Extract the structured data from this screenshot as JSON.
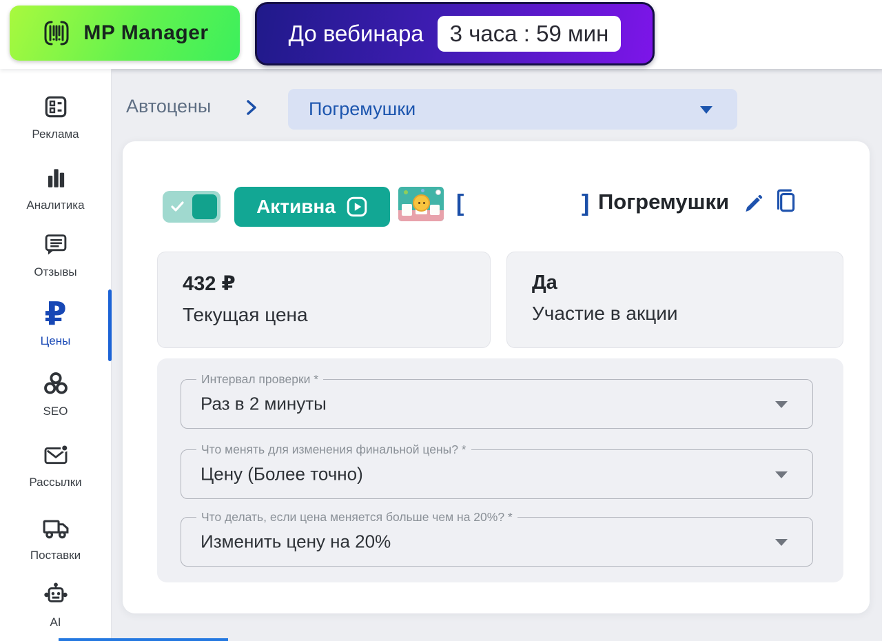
{
  "header": {
    "logo": {
      "label": "MP Manager",
      "icon": "barcode-icon"
    },
    "webinar": {
      "label": "До вебинара",
      "countdown": "3 часа : 59 мин"
    }
  },
  "sidebar": {
    "items": [
      {
        "label": "Реклама",
        "icon": "ads-icon",
        "active": false
      },
      {
        "label": "Аналитика",
        "icon": "analytics-icon",
        "active": false
      },
      {
        "label": "Отзывы",
        "icon": "reviews-icon",
        "active": false
      },
      {
        "label": "Цены",
        "icon": "ruble-icon",
        "icon_glyph": "₽",
        "active": true
      },
      {
        "label": "SEO",
        "icon": "seo-icon",
        "active": false
      },
      {
        "label": "Рассылки",
        "icon": "mailing-icon",
        "active": false
      },
      {
        "label": "Поставки",
        "icon": "truck-icon",
        "active": false
      },
      {
        "label": "AI",
        "icon": "robot-icon",
        "active": false
      }
    ]
  },
  "breadcrumb": {
    "root": "Автоцены",
    "current": "Погремушки"
  },
  "strategy": {
    "toggle_on": true,
    "status_label": "Активна",
    "bracket_open": "[",
    "bracket_close": "]",
    "product_name": "Погремушки",
    "info_cards": [
      {
        "value": "432 ₽",
        "label": "Текущая цена"
      },
      {
        "value": "Да",
        "label": "Участие в акции"
      }
    ],
    "form_fields": [
      {
        "label": "Интервал проверки *",
        "value": "Раз в 2 минуты"
      },
      {
        "label": "Что менять для изменения финальной цены? *",
        "value": "Цену (Более точно)"
      },
      {
        "label": "Что делать, если цена меняется больше чем на 20%? *",
        "value": "Изменить цену на 20%"
      }
    ]
  },
  "icons": [
    "barcode-icon",
    "ads-icon",
    "analytics-icon",
    "reviews-icon",
    "ruble-icon",
    "seo-icon",
    "mailing-icon",
    "truck-icon",
    "robot-icon",
    "chevron-right-icon",
    "dropdown-arrow-icon",
    "check-icon",
    "play-icon",
    "edit-icon",
    "copy-icon"
  ],
  "colors": {
    "accent_teal": "#12a794",
    "toggle_track": "#a0d9cf",
    "accent_blue": "#1e52ad",
    "active_nav_blue": "#1c63d6",
    "breadcrumb_pill_bg": "#d9e1f4",
    "banner_navy": "#201a8a",
    "banner_purple": "#7d15e9",
    "logo_green_light": "#a9f93e",
    "logo_green": "#3cf05c",
    "card_bg": "#f1f2f5",
    "form_bg": "#eff0f4"
  }
}
